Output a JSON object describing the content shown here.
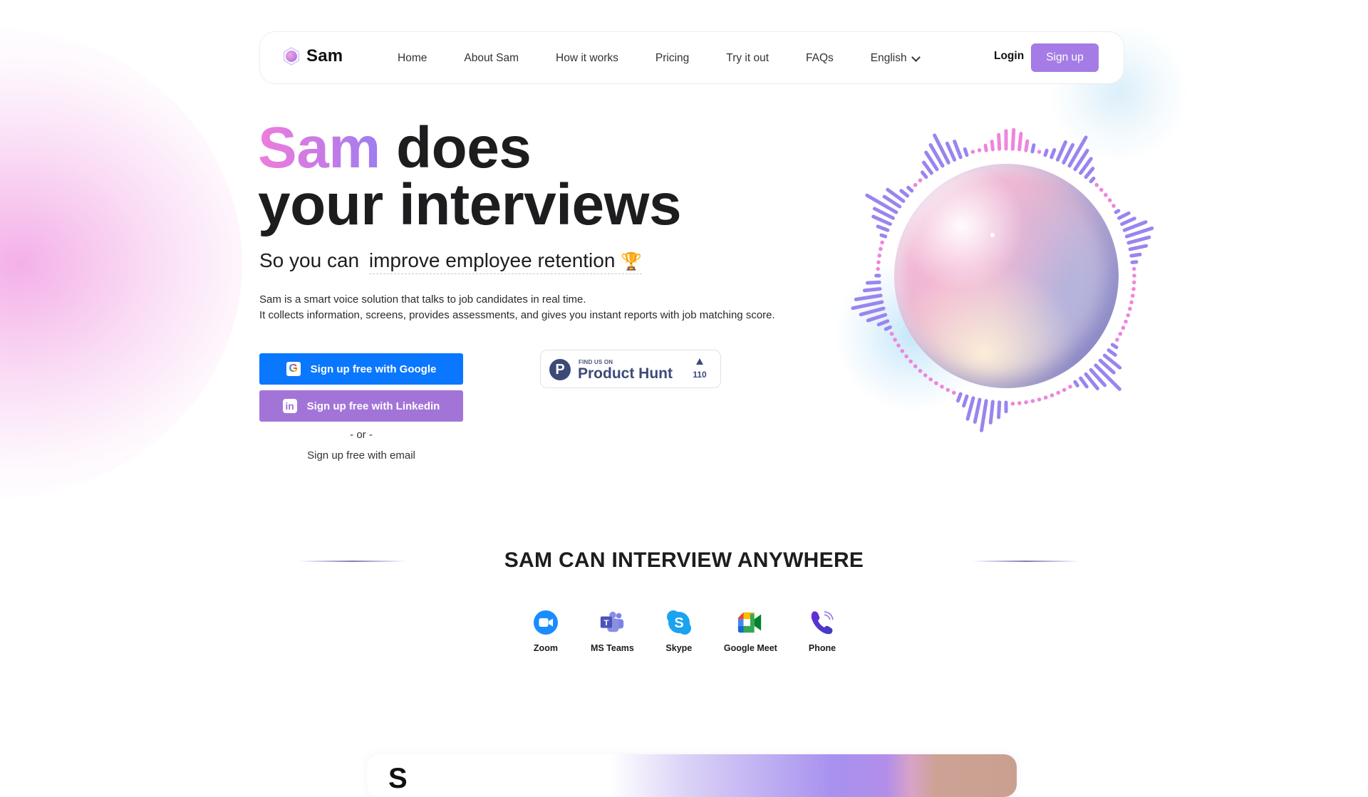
{
  "brand": {
    "name": "Sam",
    "accent_gradient": [
      "#ee7ddc",
      "#9b7ef0"
    ]
  },
  "nav": {
    "links": [
      "Home",
      "About Sam",
      "How it works",
      "Pricing",
      "Try it out",
      "FAQs"
    ],
    "language": "English",
    "login_label": "Login",
    "signup_label": "Sign up",
    "signup_color": "#a57be6"
  },
  "hero": {
    "title_accent": "Sam",
    "title_rest_line1": "does",
    "title_line2": "your interviews",
    "subtitle_prefix": "So you can",
    "subtitle_highlight": "improve employee retention",
    "subtitle_emoji": "🏆",
    "description": [
      "Sam is a smart voice solution that talks to job candidates in real time.",
      "It collects information, screens, provides assessments, and gives you instant reports with job matching score."
    ],
    "google_button": {
      "label": "Sign up free with Google",
      "icon": "google-icon",
      "color": "#0a77ff"
    },
    "linkedin_button": {
      "label": "Sign up free with Linkedin",
      "icon": "linkedin-icon",
      "color": "#a374d8"
    },
    "or_text": "- or -",
    "email_link": "Sign up free with email"
  },
  "product_hunt": {
    "small_text": "FIND US ON",
    "name": "Product Hunt",
    "logo_letter": "P",
    "upvotes": "110"
  },
  "section": {
    "title": "SAM CAN INTERVIEW ANYWHERE",
    "platforms": [
      {
        "label": "Zoom",
        "icon": "zoom-icon"
      },
      {
        "label": "MS Teams",
        "icon": "ms-teams-icon"
      },
      {
        "label": "Skype",
        "icon": "skype-icon"
      },
      {
        "label": "Google Meet",
        "icon": "google-meet-icon"
      },
      {
        "label": "Phone",
        "icon": "phone-icon"
      }
    ]
  },
  "bottom_card": {
    "partial_heading": "S"
  }
}
